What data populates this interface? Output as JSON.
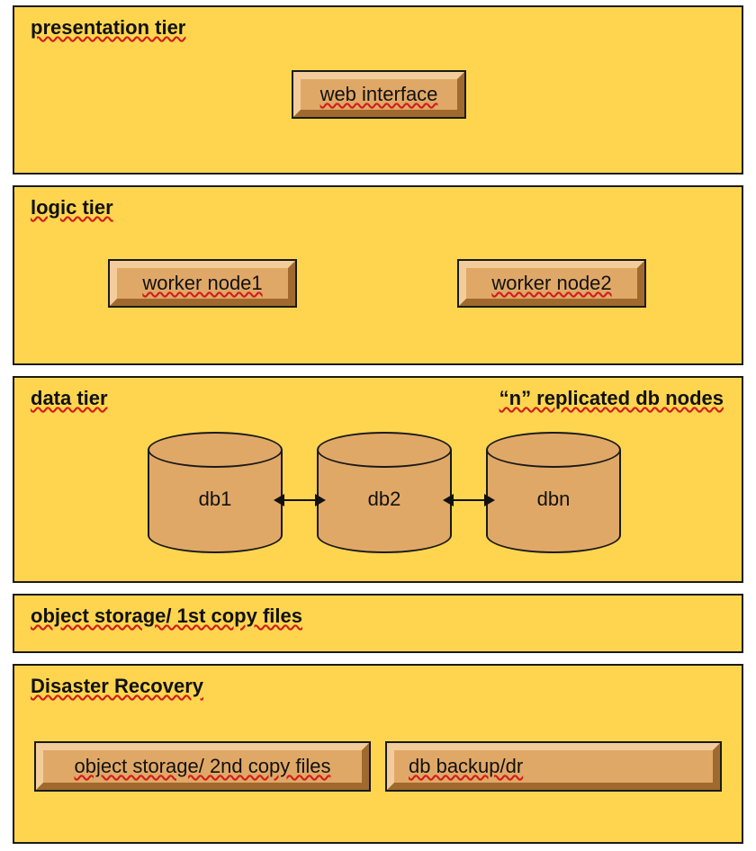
{
  "tiers": {
    "presentation": {
      "title": "presentation tier",
      "nodes": {
        "web_interface": "web interface"
      }
    },
    "logic": {
      "title": "logic tier",
      "nodes": {
        "worker1": "worker node1",
        "worker2": "worker node2"
      }
    },
    "data": {
      "title": "data tier",
      "note": "“n” replicated db nodes",
      "dbs": {
        "db1": "db1",
        "db2": "db2",
        "dbn": "dbn"
      }
    },
    "object_storage": {
      "title": "object storage/ 1st copy files"
    },
    "disaster_recovery": {
      "title": "Disaster Recovery",
      "nodes": {
        "second_copy": "object storage/ 2nd copy files",
        "db_backup": "db backup/dr"
      }
    }
  }
}
